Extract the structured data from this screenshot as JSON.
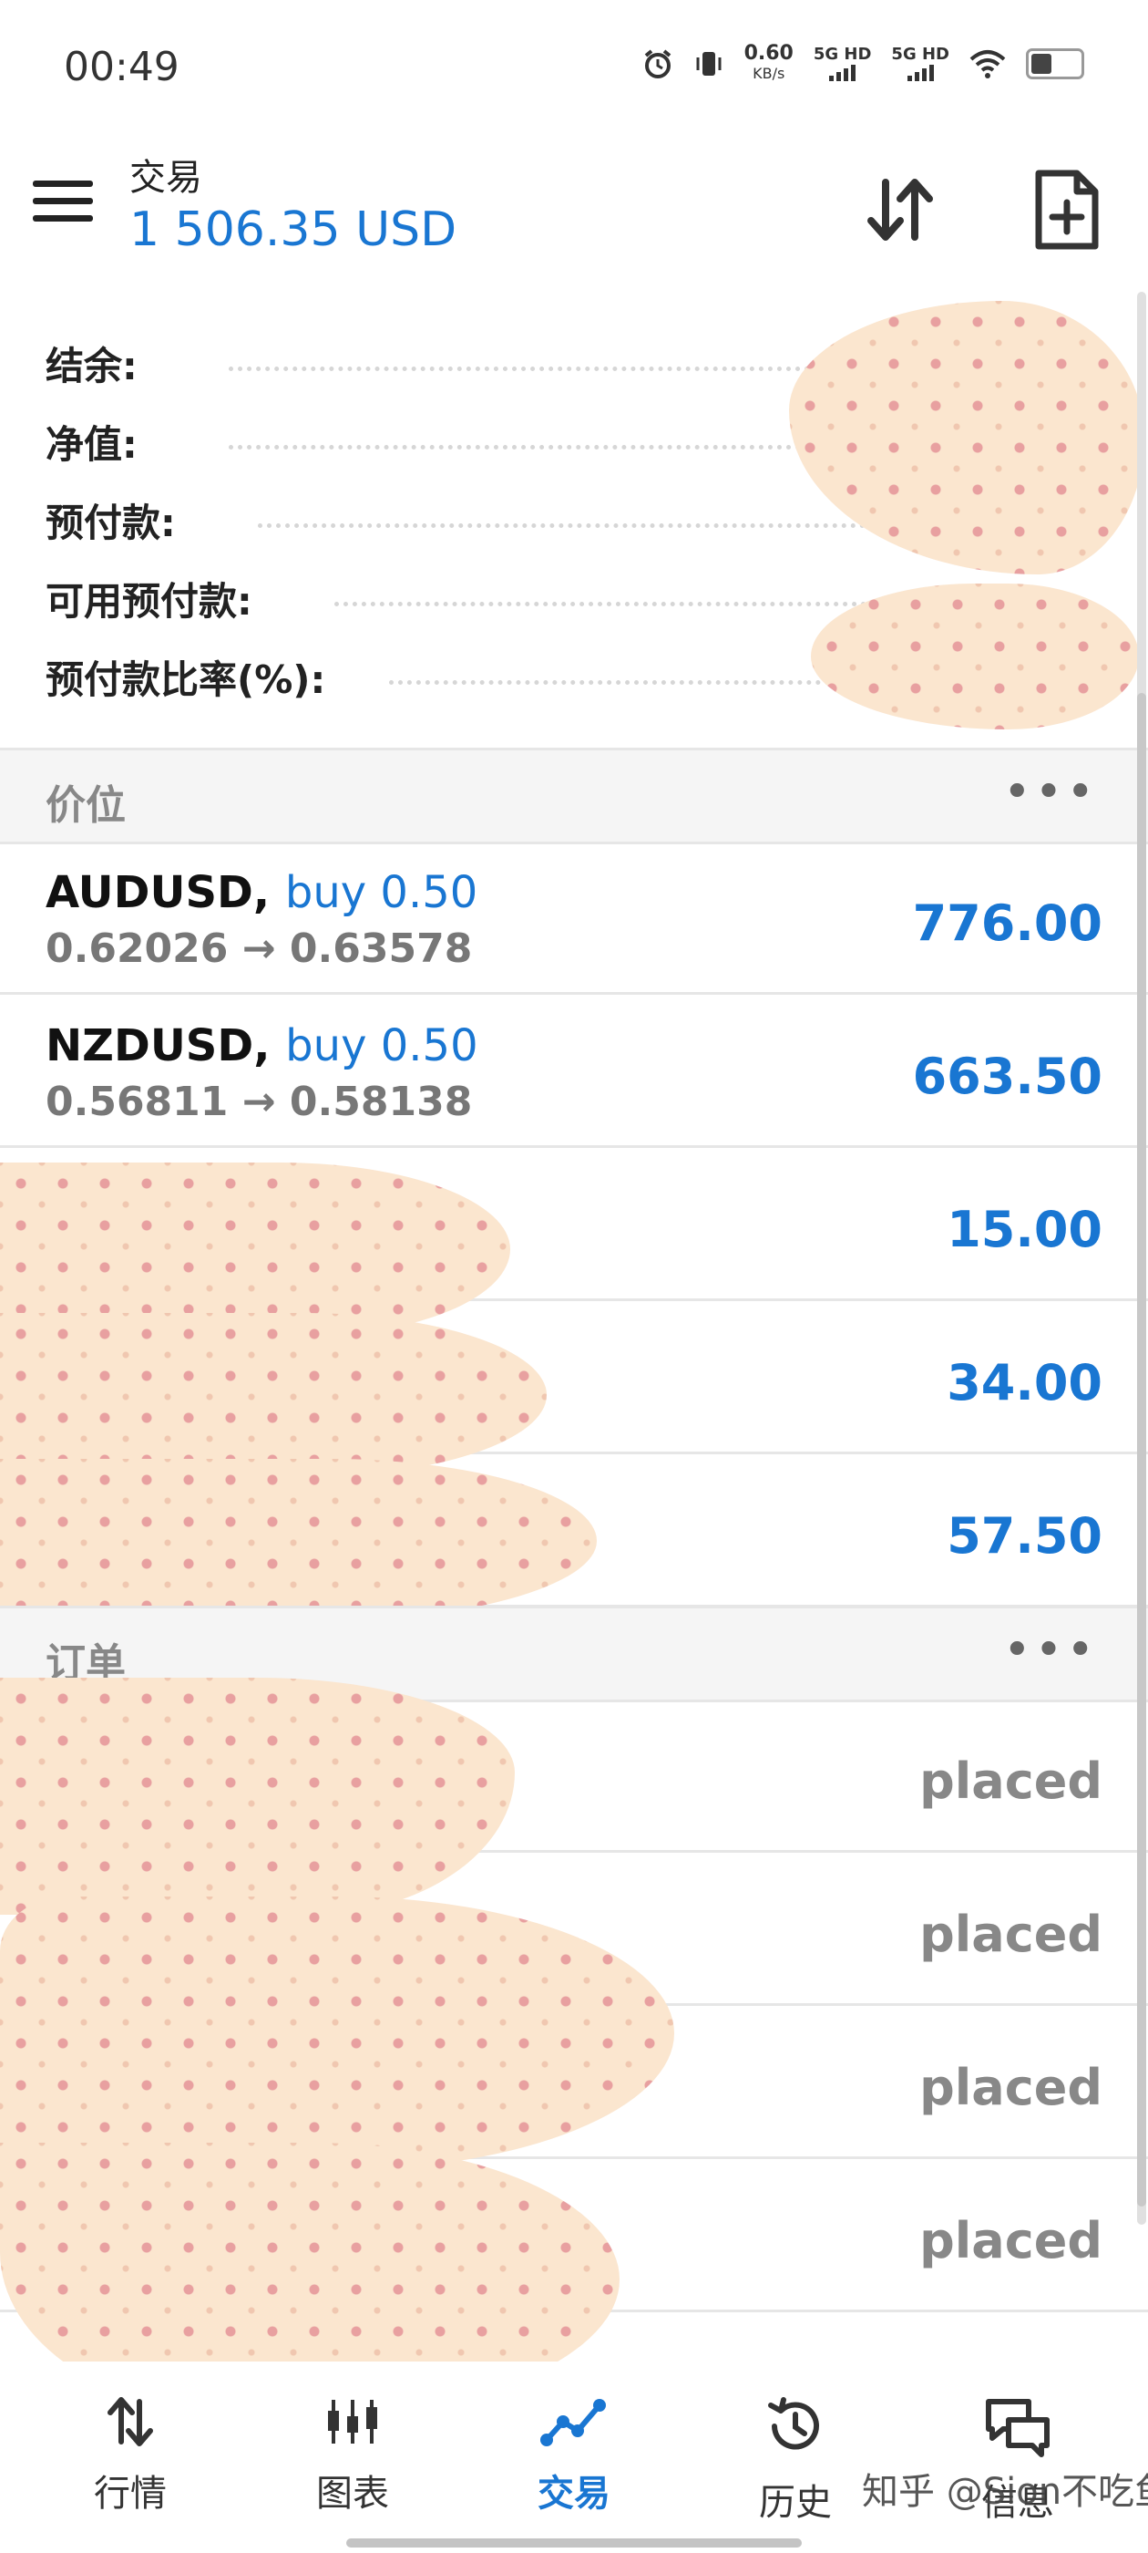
{
  "status_bar": {
    "time": "00:49",
    "net_speed": "0.60",
    "net_unit": "KB/s",
    "sim1": "5G HD",
    "sim2": "5G HD"
  },
  "header": {
    "title": "交易",
    "balance": "1 506.35 USD"
  },
  "account_summary": [
    {
      "label": "结余:"
    },
    {
      "label": "净值:"
    },
    {
      "label": "预付款:"
    },
    {
      "label": "可用预付款:"
    },
    {
      "label": "预付款比率(%):"
    }
  ],
  "positions_section": {
    "title": "价位",
    "more": "•••",
    "rows": [
      {
        "symbol": "AUDUSD,",
        "side": "buy 0.50",
        "prices": "0.62026 → 0.63578",
        "profit": "776.00"
      },
      {
        "symbol": "NZDUSD,",
        "side": "buy 0.50",
        "prices": "0.56811 → 0.58138",
        "profit": "663.50"
      },
      {
        "symbol": "",
        "side": "",
        "prices": "",
        "profit": "15.00"
      },
      {
        "symbol": "",
        "side": "",
        "prices": "",
        "profit": "34.00"
      },
      {
        "symbol": "",
        "side": "",
        "prices": "",
        "profit": "57.50"
      }
    ]
  },
  "orders_section": {
    "title": "订单",
    "more": "•••",
    "rows": [
      {
        "status": "placed"
      },
      {
        "status": "placed"
      },
      {
        "status": "placed"
      },
      {
        "status": "placed"
      }
    ]
  },
  "bottom_nav": [
    {
      "label": "行情",
      "icon": "quotes-arrows-icon"
    },
    {
      "label": "图表",
      "icon": "candlestick-chart-icon"
    },
    {
      "label": "交易",
      "icon": "trade-line-icon",
      "active": true
    },
    {
      "label": "历史",
      "icon": "history-clock-icon"
    },
    {
      "label": "信息",
      "icon": "chat-messages-icon"
    }
  ],
  "watermark": "知乎 @Sion不吃鱼",
  "colors": {
    "accent": "#1976d2",
    "section_bg": "#f5f5f5",
    "muted_text": "#888888"
  }
}
